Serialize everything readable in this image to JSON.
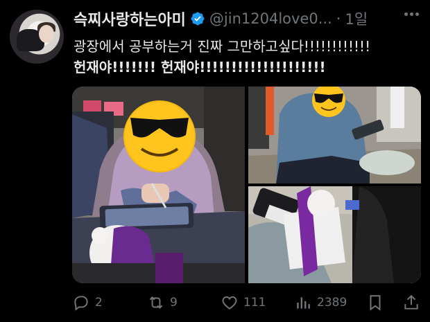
{
  "tweet": {
    "display_name": "슥찌사랑하는아미",
    "handle": "@jin1204love0...",
    "separator": "·",
    "time": "1일",
    "line1": "광장에서 공부하는거 진짜 그만하고싶다!!!!!!!!!!!!",
    "line2": "헌재야!!!!!!! 헌재야!!!!!!!!!!!!!!!!!!!!"
  },
  "actions": {
    "replies": "2",
    "reposts": "9",
    "likes": "111",
    "views": "2389"
  },
  "colors": {
    "verified": "#1d9bf0",
    "muted": "#71767b",
    "text": "#e7e9ea",
    "background": "#000000"
  },
  "icons": [
    "verified-badge-icon",
    "more-icon",
    "reply-icon",
    "repost-icon",
    "like-icon",
    "views-icon",
    "bookmark-icon",
    "share-icon"
  ]
}
